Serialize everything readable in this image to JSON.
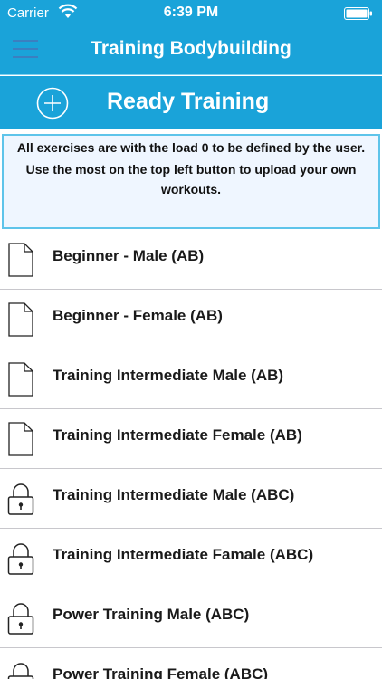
{
  "status_bar": {
    "carrier": "Carrier",
    "time": "6:39 PM"
  },
  "nav": {
    "title": "Training Bodybuilding",
    "menu_icon": "hamburger-menu-icon"
  },
  "ready_bar": {
    "label": "Ready Training",
    "icon": "plus-circle-icon"
  },
  "notice": {
    "line1": "All exercises are with the load 0 to be defined by the user.",
    "line2": "Use the most on the top left button to upload your own workouts."
  },
  "colors": {
    "header_blue": "#1aa3d9",
    "notice_border": "#5ec4ea",
    "menu_icon": "#3b7fc0"
  },
  "workouts": [
    {
      "label": "Beginner - Male (AB)",
      "icon": "document-icon"
    },
    {
      "label": "Beginner - Female (AB)",
      "icon": "document-icon"
    },
    {
      "label": "Training Intermediate Male (AB)",
      "icon": "document-icon"
    },
    {
      "label": "Training Intermediate Female (AB)",
      "icon": "document-icon"
    },
    {
      "label": "Training Intermediate Male (ABC)",
      "icon": "lock-icon"
    },
    {
      "label": "Training Intermediate Famale (ABC)",
      "icon": "lock-icon"
    },
    {
      "label": "Power Training Male (ABC)",
      "icon": "lock-icon"
    },
    {
      "label": "Power Training Female (ABC)",
      "icon": "lock-icon"
    }
  ]
}
